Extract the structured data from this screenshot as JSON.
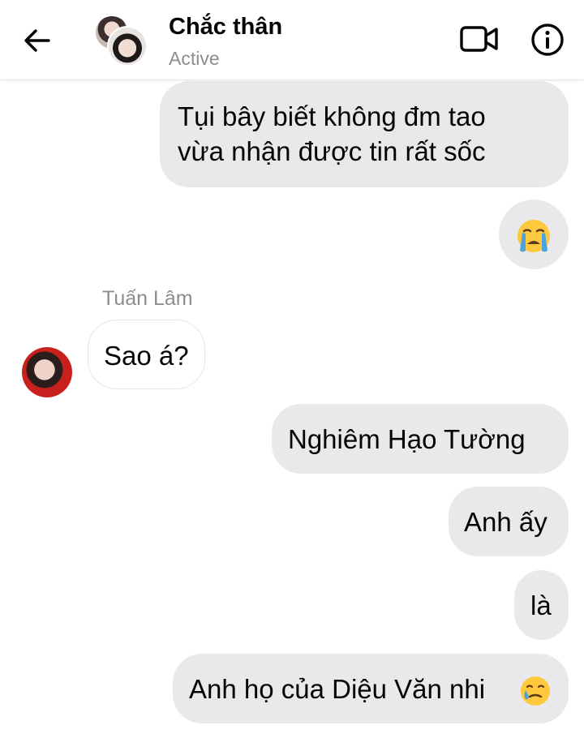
{
  "header": {
    "contact_name": "Chắc thân",
    "status": "Active",
    "back_icon": "arrow-left-icon",
    "video_icon": "video-camera-icon",
    "info_icon": "info-icon"
  },
  "messages": [
    {
      "id": "m1",
      "direction": "outgoing",
      "lines": [
        "Tụi bây biết không đm tao",
        "vừa nhận được tin rất sốc"
      ]
    },
    {
      "id": "m2",
      "direction": "outgoing",
      "emoji": "crying-face-emoji"
    },
    {
      "id": "m3",
      "direction": "incoming",
      "sender": "Tuấn Lâm",
      "text": "Sao á?"
    },
    {
      "id": "m4",
      "direction": "outgoing",
      "text": "Nghiêm Hạo Tường"
    },
    {
      "id": "m5",
      "direction": "outgoing",
      "text": "Anh ấy"
    },
    {
      "id": "m6",
      "direction": "outgoing",
      "text": "là"
    },
    {
      "id": "m7",
      "direction": "outgoing",
      "text": "Anh họ của Diệu Văn nhi",
      "emoji": "smiling-face-with-tear-emoji"
    }
  ],
  "colors": {
    "outgoing_bubble": "#e9e9eb",
    "incoming_bubble": "#ffffff",
    "muted_text": "#8a8d91",
    "emoji_yellow": "#ffc83d",
    "tear_blue": "#4aa3df"
  }
}
